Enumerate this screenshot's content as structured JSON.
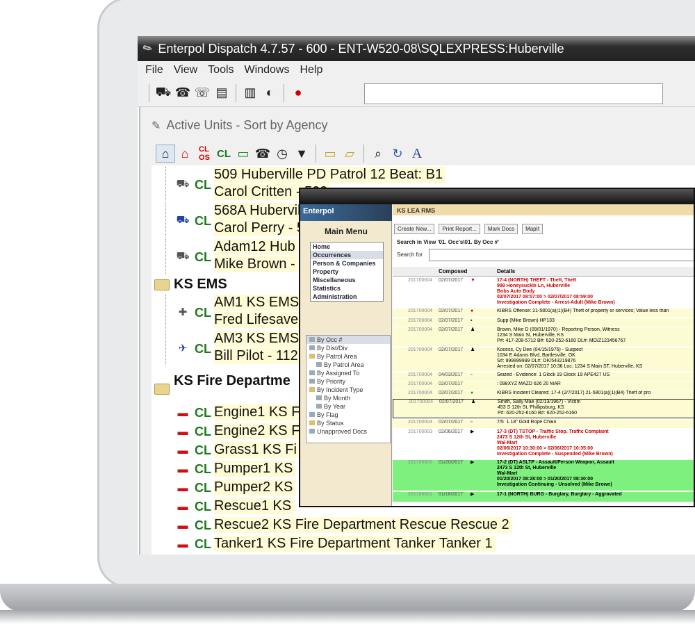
{
  "window": {
    "title": "Enterpol Dispatch 4.7.57 - 600 - ENT-W520-08\\SQLEXPRESS:Huberville"
  },
  "menu": {
    "file": "File",
    "view": "View",
    "tools": "Tools",
    "windows": "Windows",
    "help": "Help"
  },
  "pane": {
    "title": "Active Units - Sort by Agency"
  },
  "units": {
    "u1": {
      "cl": "CL",
      "line1": "509  Huberville PD Patrol 12  Beat: B1",
      "line2": "Carol Critten - 509"
    },
    "u2": {
      "cl": "CL",
      "line1": "568A  Huberville",
      "line2": "Carol Perry - 5"
    },
    "u3": {
      "cl": "CL",
      "line1": "Adam12  Hub",
      "line2": "Mike Brown -"
    },
    "g_ems": "KS EMS",
    "u4": {
      "cl": "CL",
      "line1": "AM1  KS EMS",
      "line2": "Fred Lifesave"
    },
    "u5": {
      "cl": "CL",
      "line1": "AM3  KS EMS",
      "line2": "Bill Pilot - 112"
    },
    "g_fire": "KS Fire Departme",
    "f1": {
      "cl": "CL",
      "text": "Engine1  KS F"
    },
    "f2": {
      "cl": "CL",
      "text": "Engine2  KS F"
    },
    "f3": {
      "cl": "CL",
      "text": "Grass1  KS Fi"
    },
    "f4": {
      "cl": "CL",
      "text": "Pumper1  KS"
    },
    "f5": {
      "cl": "CL",
      "text": "Pumper2  KS"
    },
    "f6": {
      "cl": "CL",
      "text": "Rescue1  KS"
    },
    "f7": {
      "cl": "CL",
      "text": "Rescue2  KS Fire Department Rescue Rescue 2"
    },
    "f8": {
      "cl": "CL",
      "text": "Tanker1  KS Fire Department Tanker Tanker 1"
    }
  },
  "rms": {
    "logo": "Enterpol",
    "header": "KS LEA RMS",
    "main_menu": "Main Menu",
    "menu_items": [
      "Home",
      "Occurrences",
      "Person & Companies",
      "Property",
      "Miscellaneous",
      "Statistics",
      "Administration"
    ],
    "tree": [
      "By Occ #",
      "By Dist/Div",
      "By Patrol Area",
      "By Patrol Area",
      "By Assigned To",
      "By Priority",
      "By Incident Type",
      "By Month",
      "By Year",
      "By Flag",
      "By Status",
      "Unapproved Docs"
    ],
    "btn_create": "Create New...",
    "btn_print": "Print Report...",
    "btn_mark": "Mark Docs",
    "btn_mapit": "MapIt",
    "view_text": "Search in View '01. Occ's\\01. By Occ #'",
    "search_label": "Search for",
    "col_composed": "Composed",
    "col_details": "Details",
    "rows": [
      {
        "num": "201700004",
        "date": "02/07/2017",
        "det": "17-4 (NORTH) THEFT - Theft, Theft\n999 Honeysuckle Ln, Huberville\nBobs Auto Body\n02/07/2017 08:57:00 > 02/07/2017 08:59:00\nInvestigation Complete - Arrest-Adult (Mike Brown)"
      },
      {
        "num": "201700004",
        "date": "02/07/2017",
        "det": "KIBRS Offense: 21-5801(a)(1)(B4) Theft of property or services; Value less than"
      },
      {
        "num": "201700004",
        "date": "02/07/2017",
        "det": "Supp (Mike Brown) HP133"
      },
      {
        "num": "201700004",
        "date": "02/07/2017",
        "det": "Brown, Mike D (09/01/1970) - Reporting Person, Witness\n1234 S Main St, Huberville, KS\nP#: 417-208-5712 B#: 620-252-6160 DL#: MO/Z123456767"
      },
      {
        "num": "201700004",
        "date": "02/07/2017",
        "det": "Kocess, Cy Dee (04/15/1975) - Suspect\n1034 E Adams Blvd, Bartlesville, OK\nS#: 999999999 DL#: OK/543219876\nArrested on: 02/07/2017 10:36 Loc: 1234 S Main ST, Huberville, KS"
      },
      {
        "num": "201700004",
        "date": "04/03/2017",
        "det": "Seized - Evidence: 1 Glock 19 Glock 19 APE427 US"
      },
      {
        "num": "201700004",
        "date": "02/07/2017",
        "det": ": 098XYZ MAZD 626 20 MAR"
      },
      {
        "num": "201700004",
        "date": "02/07/2017",
        "det": "KIBRS Incident Cleared: 17-4 (2/7/2017) 21-5801(a)(1)(B4) Theft of pro"
      },
      {
        "num": "201700004",
        "date": "02/07/2017",
        "det": "Smith, Sally Mae (02/13/1967) - Victim\n453 S 12th St, Phillipsburg, KS\nP#: 620-252-6160 B#: 620-252-6160"
      },
      {
        "num": "201700004",
        "date": "02/07/2017",
        "det": "7/5  1.18\" Gold Rope Chain"
      },
      {
        "num": "201700003",
        "date": "02/06/2017",
        "det": "17-3 (DT) TSTOP - Traffic Stop, Traffic Complaint\n2473 S 12th St, Huberville\nWal-Mart\n02/06/2017 10:30:00 > 02/06/2017 10:35:00\nInvestigation Complete - Suspended (Mike Brown)"
      },
      {
        "num": "201700002",
        "date": "01/20/2017",
        "det": "17-2 (DT) ASLTP - Assault/Person Weapon, Assault\n2473 S 12th St, Huberville\nWal-Mart\n01/20/2017 08:28:00 > 01/20/2017 08:30:00\nInvestigation Continuing - Unsolved (Mike Brown)"
      },
      {
        "num": "201700001",
        "date": "01/16/2017",
        "det": "17-1 (NORTH) BURG - Burglary, Burglary - Aggravated"
      }
    ]
  }
}
